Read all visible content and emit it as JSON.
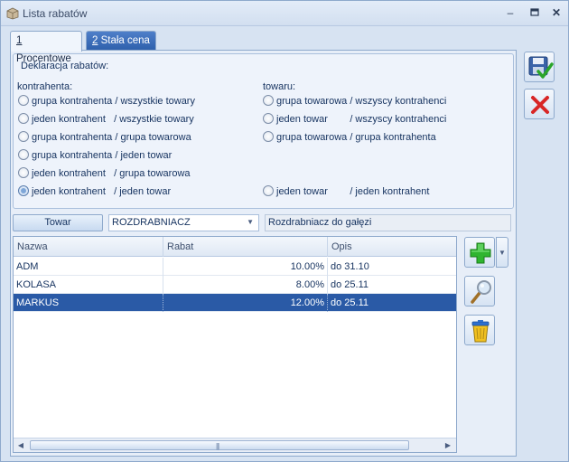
{
  "window": {
    "title": "Lista rabatów"
  },
  "tabs": [
    {
      "key": "1",
      "rest": " Procentowe",
      "active": true
    },
    {
      "key": "2",
      "rest": " Stała cena",
      "active": false
    }
  ],
  "declaration": {
    "header": "Deklaracja rabatów:",
    "contractor_label": "kontrahenta:",
    "goods_label": "towaru:",
    "left_options": [
      {
        "label": "grupa kontrahenta / wszystkie towary",
        "checked": false
      },
      {
        "label": "jeden kontrahent   / wszystkie towary",
        "checked": false
      },
      {
        "label": "grupa kontrahenta / grupa towarowa",
        "checked": false
      },
      {
        "label": "grupa kontrahenta / jeden towar",
        "checked": false
      },
      {
        "label": "jeden kontrahent   / grupa towarowa",
        "checked": false
      },
      {
        "label": "jeden kontrahent   / jeden towar",
        "checked": true
      }
    ],
    "right_options": [
      {
        "label": "grupa towarowa / wszyscy kontrahenci",
        "checked": false
      },
      {
        "label": "jeden towar        / wszyscy kontrahenci",
        "checked": false
      },
      {
        "label": "grupa towarowa / grupa kontrahenta",
        "checked": false
      },
      {
        "label": "jeden towar        / jeden kontrahent",
        "checked": false
      }
    ]
  },
  "selector": {
    "button_label": "Towar",
    "combo_value": "ROZDRABNIACZ",
    "description": "Rozdrabniacz do gałęzi"
  },
  "grid": {
    "columns": [
      "Nazwa",
      "Rabat",
      "Opis"
    ],
    "rows": [
      {
        "name": "ADM",
        "rabat": "10.00%",
        "opis": "do 31.10",
        "selected": false
      },
      {
        "name": "KOLASA",
        "rabat": "8.00%",
        "opis": "do 25.11",
        "selected": false
      },
      {
        "name": "MARKUS",
        "rabat": "12.00%",
        "opis": "do 25.11",
        "selected": true
      }
    ]
  },
  "icons": {
    "save": "save-check-icon",
    "cancel": "red-x-icon",
    "add": "green-plus-icon",
    "edit": "magnifier-icon",
    "delete": "trash-bin-icon"
  },
  "colors": {
    "selected_row": "#2a5aa6",
    "active_tab": "#f0f5fc",
    "inactive_tab": "#3b6cb8",
    "add_green": "#2fb52f",
    "cancel_red": "#d82626"
  }
}
